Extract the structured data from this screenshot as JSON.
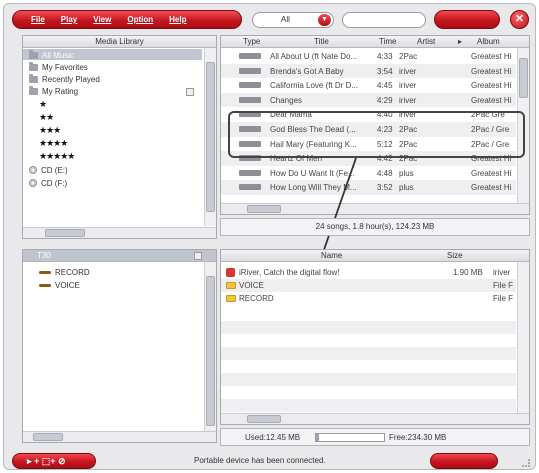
{
  "toolbar": {
    "menu": [
      "File",
      "Play",
      "View",
      "Option",
      "Help"
    ],
    "filter_value": "All",
    "close_label": "✕"
  },
  "library": {
    "header": "Media Library",
    "items": [
      {
        "label": "All Music",
        "icon": "folder-icon"
      },
      {
        "label": "My Favorites",
        "icon": "folder-icon"
      },
      {
        "label": "Recently Played",
        "icon": "folder-icon"
      },
      {
        "label": "My Rating",
        "icon": "folder-icon"
      },
      {
        "label": "★",
        "icon": "star-rating"
      },
      {
        "label": "★★",
        "icon": "star-rating"
      },
      {
        "label": "★★★",
        "icon": "star-rating"
      },
      {
        "label": "★★★★",
        "icon": "star-rating"
      },
      {
        "label": "★★★★★",
        "icon": "star-rating"
      },
      {
        "label": "CD (E:)",
        "icon": "cd-icon"
      },
      {
        "label": "CD (F:)",
        "icon": "cd-icon"
      }
    ]
  },
  "tracks": {
    "columns": [
      "Type",
      "Title",
      "Time",
      "Artist",
      "▸",
      "Album"
    ],
    "rows": [
      {
        "title": "All About U (ft Nate Do...",
        "time": "4:33",
        "artist": "2Pac",
        "album": "Greatest Hi"
      },
      {
        "title": "Brenda's Got A Baby",
        "time": "3:54",
        "artist": "iriver",
        "album": "Greatest Hi"
      },
      {
        "title": "California Love (ft Dr D...",
        "time": "4:45",
        "artist": "iriver",
        "album": "Greatest Hi"
      },
      {
        "title": "Changes",
        "time": "4:29",
        "artist": "iriver",
        "album": "Greatest Hi"
      },
      {
        "title": "Dear Mama",
        "time": "4:40",
        "artist": "iriver",
        "album": "2Pac Gre"
      },
      {
        "title": "God Bless The Dead (...",
        "time": "4:23",
        "artist": "2Pac",
        "album": "2Pac / Gre"
      },
      {
        "title": "Hail Mary (Featuring K...",
        "time": "5:12",
        "artist": "2Pac",
        "album": "2Pac / Gre"
      },
      {
        "title": "Heartz Of Men",
        "time": "4:42",
        "artist": "2Pac",
        "album": "Greatest Hi"
      },
      {
        "title": "How Do U Want It (Fe...",
        "time": "4:48",
        "artist": "plus",
        "album": "Greatest Hi"
      },
      {
        "title": "How Long Will They M...",
        "time": "3:52",
        "artist": "plus",
        "album": "Greatest Hi"
      }
    ],
    "summary": "24 songs, 1.8 hour(s), 124.23 MB"
  },
  "device": {
    "header": "T30",
    "folders": [
      "RECORD",
      "VOICE"
    ],
    "columns": [
      "Name",
      "Size"
    ],
    "files": [
      {
        "name": "iRiver, Catch the digital flow!",
        "size": "1.90 MB",
        "extra": "iriver",
        "icon": "device-icon"
      },
      {
        "name": "VOICE",
        "size": "",
        "extra": "File F",
        "icon": "folder-icon"
      },
      {
        "name": "RECORD",
        "size": "",
        "extra": "File F",
        "icon": "folder-icon"
      }
    ],
    "used": "Used:12.45 MB",
    "free": "Free:234.30 MB",
    "usage_fraction": 0.05
  },
  "bottom": {
    "controls": "▸ + ⬚+ ⊘",
    "status": "Portable device has been connected."
  }
}
